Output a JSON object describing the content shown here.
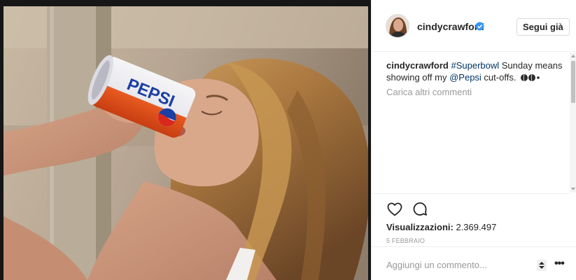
{
  "post": {
    "username": "cindycrawford",
    "follow_button": "Segui già",
    "caption": {
      "username": "cindycrawford",
      "hashtag": "#Superbowl",
      "text_1": " Sunday means showing off my ",
      "mention": "@Pepsi",
      "text_2": " cut-offs. "
    },
    "load_more": "Carica altri commenti",
    "views_label": "Visualizzazioni:",
    "views_count": "2.369.497",
    "date": "5 FEBBRAIO",
    "comment_placeholder": "Aggiungi un commento...",
    "media_can_text": "PEPSI"
  },
  "icons": {
    "verified": "verified-badge-icon",
    "like": "heart-icon",
    "comment": "comment-bubble-icon",
    "emoji": "peach-emoji-icon",
    "sort": "sort-arrows-icon",
    "more": "more-options-icon"
  },
  "colors": {
    "text": "#262626",
    "muted": "#999999",
    "link": "#003569",
    "verified": "#3897f0",
    "border": "#efefef",
    "media_bg": "#161616"
  }
}
